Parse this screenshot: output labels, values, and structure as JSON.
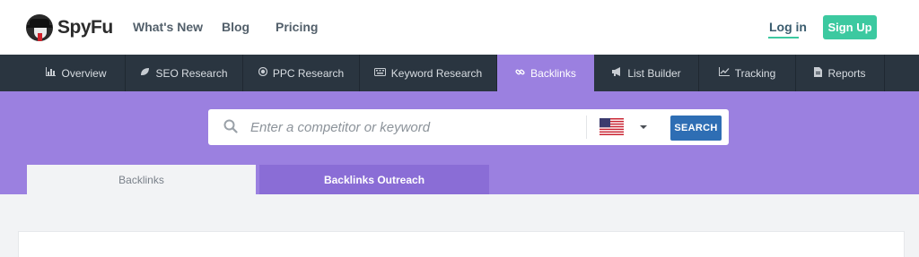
{
  "header": {
    "logo_text": "SpyFu",
    "nav": [
      {
        "label": "What's New"
      },
      {
        "label": "Blog"
      },
      {
        "label": "Pricing"
      }
    ],
    "login_label": "Log in",
    "signup_label": "Sign Up",
    "accent_color": "#3cc9a0"
  },
  "main_nav": {
    "tabs": [
      {
        "label": "Overview",
        "icon": "bar-chart-icon"
      },
      {
        "label": "SEO Research",
        "icon": "leaf-icon"
      },
      {
        "label": "PPC Research",
        "icon": "target-icon"
      },
      {
        "label": "Keyword Research",
        "icon": "keyboard-icon"
      },
      {
        "label": "Backlinks",
        "icon": "link-icon",
        "active": true
      },
      {
        "label": "List Builder",
        "icon": "megaphone-icon"
      },
      {
        "label": "Tracking",
        "icon": "line-chart-icon"
      },
      {
        "label": "Reports",
        "icon": "document-icon"
      }
    ],
    "active_color": "#9b80e0"
  },
  "search": {
    "placeholder": "Enter a competitor or keyword",
    "value": "",
    "country_icon": "us-flag-icon",
    "button_label": "SEARCH"
  },
  "sub_tabs": [
    {
      "label": "Backlinks",
      "active": true
    },
    {
      "label": "Backlinks Outreach",
      "active": false
    }
  ]
}
